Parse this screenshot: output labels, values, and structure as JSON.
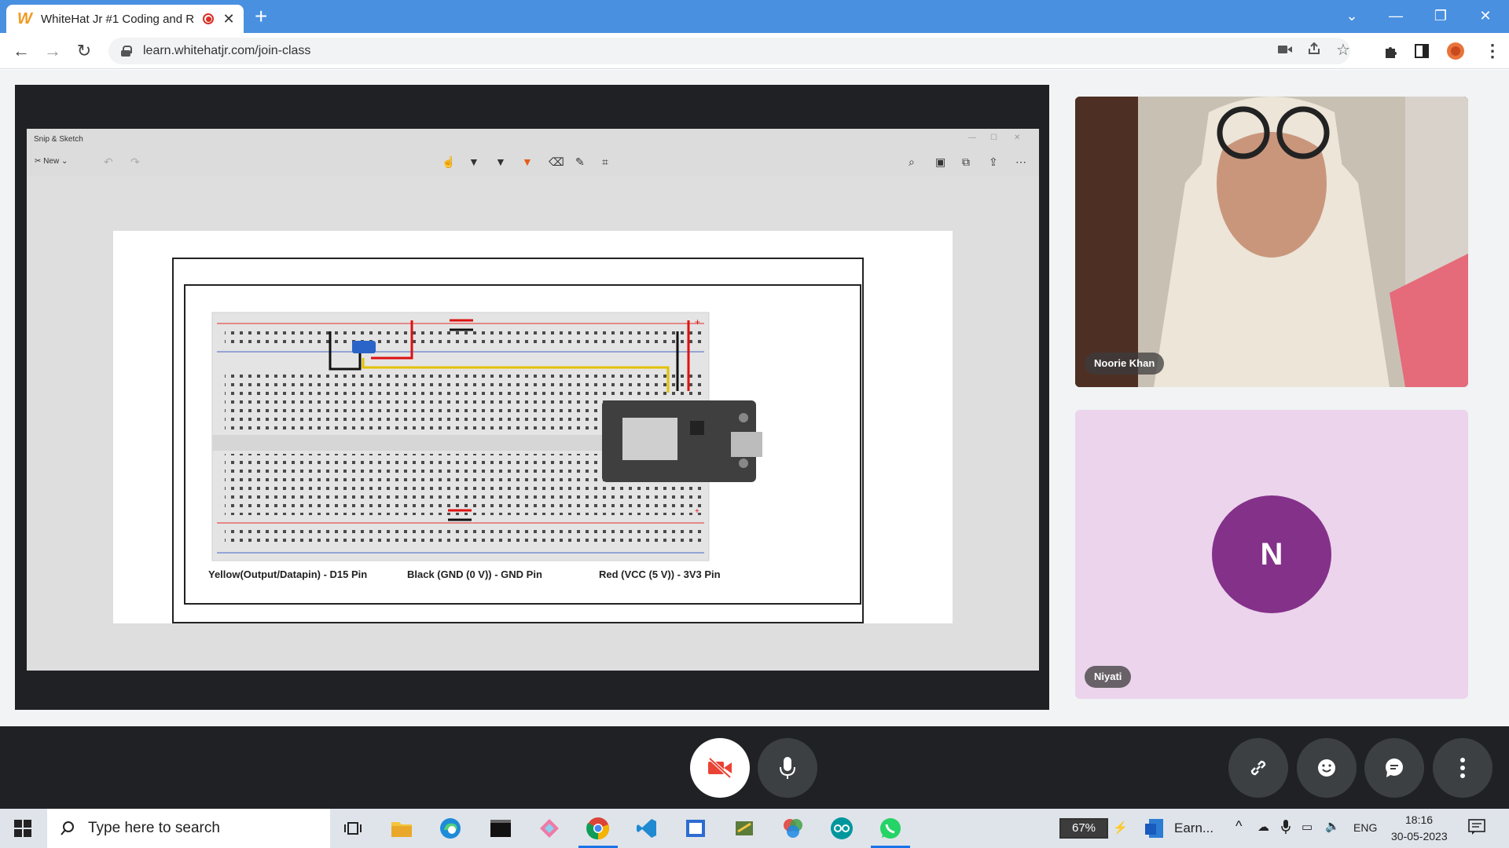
{
  "browser": {
    "tab_title": "WhiteHat Jr #1 Coding and R",
    "tab_close": "✕",
    "new_tab": "+",
    "url": "learn.whitehatjr.com/join-class",
    "favicon_letter": "W"
  },
  "snip_sketch": {
    "title": "Snip & Sketch",
    "new_label": "New",
    "pin_labels": [
      "Yellow(Output/Datapin) - D15 Pin",
      "Black (GND (0 V)) - GND Pin",
      "Red (VCC (5 V)) - 3V3 Pin"
    ]
  },
  "participants": [
    {
      "name": "Noorie Khan",
      "type": "video"
    },
    {
      "name": "Niyati",
      "type": "avatar",
      "initial": "N",
      "avatar_color": "#84318a"
    }
  ],
  "taskbar": {
    "search_placeholder": "Type here to search",
    "battery": "67%",
    "pinned_label": "Earn...",
    "language": "ENG",
    "time": "18:16",
    "date": "30-05-2023"
  },
  "colors": {
    "chrome_blue": "#4a90e0",
    "meet_dark": "#1f2124",
    "camera_off_red": "#ea4335",
    "avatar_bg": "#ecd4ec"
  },
  "icons": {
    "camera": "camera-off-icon",
    "mic": "microphone-icon",
    "link": "link-icon",
    "emoji": "emoji-icon",
    "chat": "chat-icon",
    "more": "more-vertical-icon"
  }
}
